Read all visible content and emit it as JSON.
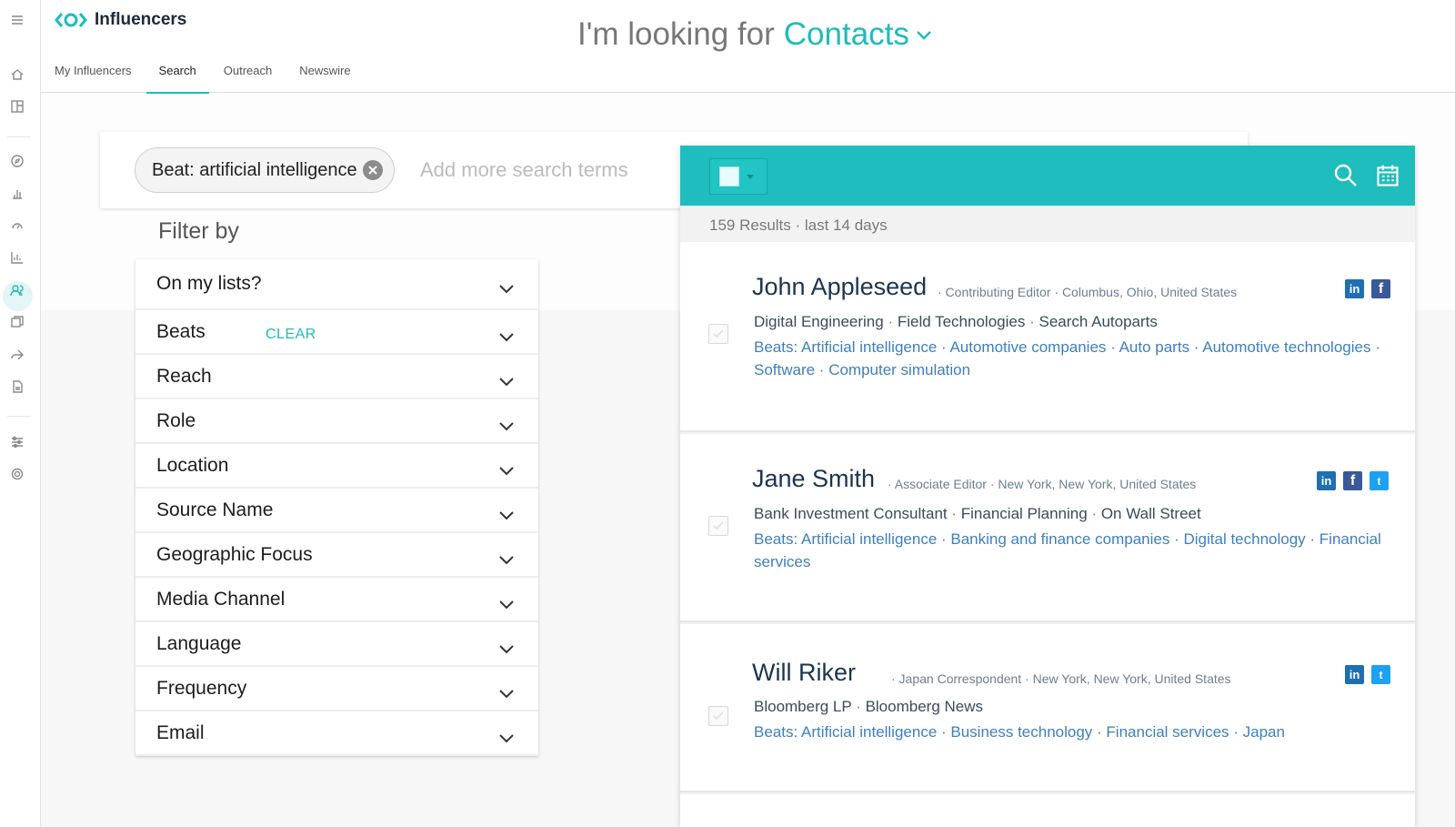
{
  "app": {
    "brand": "Influencers",
    "accent": "#1fbbbb"
  },
  "tabs": [
    {
      "label": "My Influencers",
      "active": false
    },
    {
      "label": "Search",
      "active": true
    },
    {
      "label": "Outreach",
      "active": false
    },
    {
      "label": "Newswire",
      "active": false
    }
  ],
  "headline": {
    "prefix": "I'm looking for",
    "selection": "Contacts"
  },
  "search": {
    "chip": "Beat: artificial intelligence",
    "placeholder": "Add more search terms"
  },
  "filters": {
    "title": "Filter by",
    "clear_label": "CLEAR",
    "items": [
      "On my lists?",
      "Beats",
      "Reach",
      "Role",
      "Location",
      "Source Name",
      "Geographic Focus",
      "Media Channel",
      "Language",
      "Frequency",
      "Email"
    ]
  },
  "results": {
    "summary": "159 Results · last 14 days",
    "contacts": [
      {
        "name": "John Appleseed",
        "meta": "· Contributing Editor · Columbus, Ohio, United States",
        "outlets": [
          "Digital Engineering",
          "Field Technologies",
          "Search Autoparts"
        ],
        "beats": "Beats: Artificial intelligence · Automotive companies · Auto parts · Automotive technologies · Software · Computer simulation",
        "social": [
          "linkedin",
          "facebook"
        ]
      },
      {
        "name": "Jane Smith",
        "meta": "· Associate Editor · New York, New York, United States",
        "outlets": [
          "Bank Investment Consultant",
          "Financial Planning",
          "On Wall Street"
        ],
        "beats": "Beats: Artificial intelligence · Banking and finance companies · Digital technology · Financial services",
        "social": [
          "linkedin",
          "facebook",
          "twitter"
        ]
      },
      {
        "name": "Will Riker",
        "meta": "· Japan Correspondent · New York, New York, United States",
        "outlets": [
          "Bloomberg LP",
          "Bloomberg News"
        ],
        "beats": "Beats: Artificial intelligence · Business technology · Financial services · Japan",
        "social": [
          "linkedin",
          "twitter"
        ]
      }
    ]
  }
}
